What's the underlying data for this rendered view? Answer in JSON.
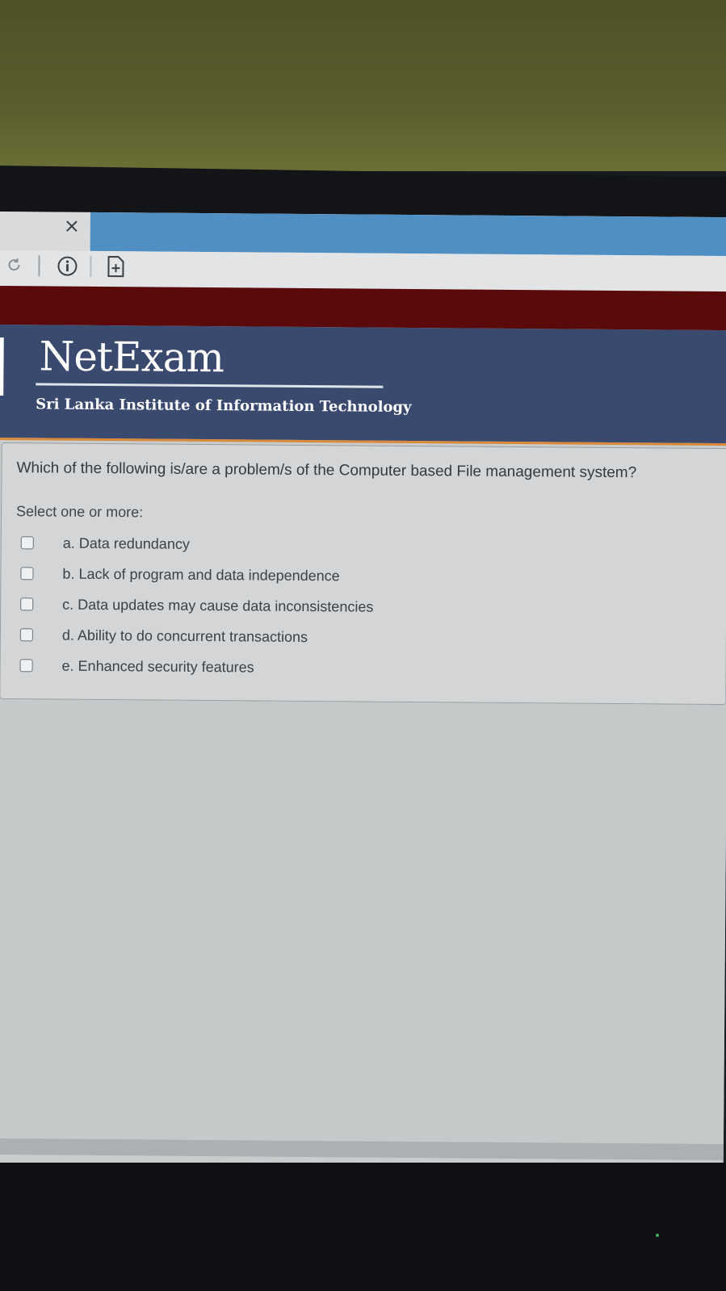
{
  "browser": {
    "close_glyph": "×",
    "colors": {
      "active_tab": "#4f8fc4",
      "maroon_bar": "#5a0a0a",
      "header_bg": "#3a4a6e",
      "accent_line": "#d98a3a"
    }
  },
  "header": {
    "brand": "NetExam",
    "institute": "Sri Lanka Institute of Information Technology"
  },
  "question": {
    "text": "Which of the following is/are a problem/s of the Computer based File management system?",
    "prompt": "Select one or more:",
    "options": [
      {
        "label": "a. Data redundancy",
        "checked": false
      },
      {
        "label": "b. Lack of program and data independence",
        "checked": false
      },
      {
        "label": "c. Data updates may cause data inconsistencies",
        "checked": false
      },
      {
        "label": "d. Ability to do concurrent transactions",
        "checked": false
      },
      {
        "label": "e. Enhanced security features",
        "checked": false
      }
    ]
  }
}
